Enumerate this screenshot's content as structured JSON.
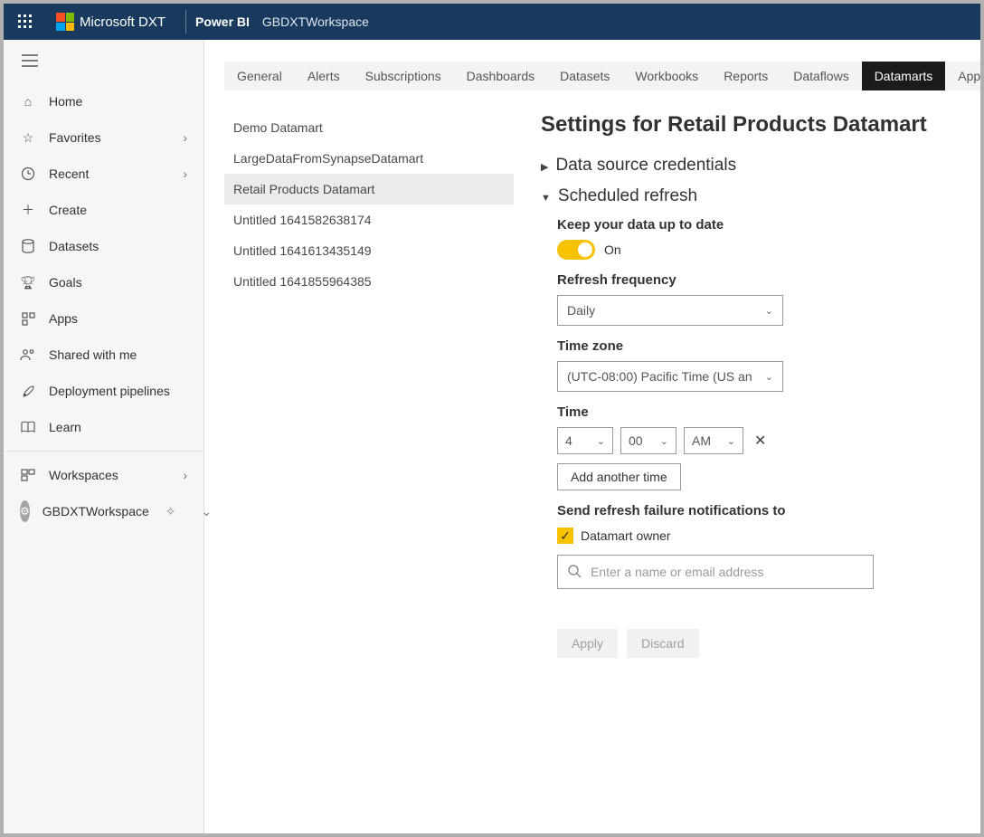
{
  "header": {
    "brand": "Microsoft",
    "brand_suffix": "DXT",
    "app": "Power BI",
    "workspace": "GBDXTWorkspace"
  },
  "sidebar": {
    "items": [
      {
        "label": "Home"
      },
      {
        "label": "Favorites",
        "chevron": true
      },
      {
        "label": "Recent",
        "chevron": true
      },
      {
        "label": "Create"
      },
      {
        "label": "Datasets"
      },
      {
        "label": "Goals"
      },
      {
        "label": "Apps"
      },
      {
        "label": "Shared with me"
      },
      {
        "label": "Deployment pipelines"
      },
      {
        "label": "Learn"
      }
    ],
    "workspaces_label": "Workspaces",
    "current_workspace": "GBDXTWorkspace"
  },
  "tabs": [
    "General",
    "Alerts",
    "Subscriptions",
    "Dashboards",
    "Datasets",
    "Workbooks",
    "Reports",
    "Dataflows",
    "Datamarts",
    "App"
  ],
  "active_tab": "Datamarts",
  "datamarts": [
    "Demo Datamart",
    "LargeDataFromSynapseDatamart",
    "Retail Products Datamart",
    "Untitled 1641582638174",
    "Untitled 1641613435149",
    "Untitled 1641855964385"
  ],
  "selected_datamart": "Retail Products Datamart",
  "settings": {
    "title": "Settings for Retail Products Datamart",
    "section_credentials": "Data source credentials",
    "section_refresh": "Scheduled refresh",
    "keep_label": "Keep your data up to date",
    "toggle_state_label": "On",
    "freq_label": "Refresh frequency",
    "freq_value": "Daily",
    "tz_label": "Time zone",
    "tz_value": "(UTC-08:00) Pacific Time (US an",
    "time_label": "Time",
    "time_hour": "4",
    "time_min": "00",
    "time_ampm": "AM",
    "add_time_label": "Add another time",
    "notify_label": "Send refresh failure notifications to",
    "notify_owner": "Datamart owner",
    "search_placeholder": "Enter a name or email address",
    "apply_label": "Apply",
    "discard_label": "Discard"
  }
}
